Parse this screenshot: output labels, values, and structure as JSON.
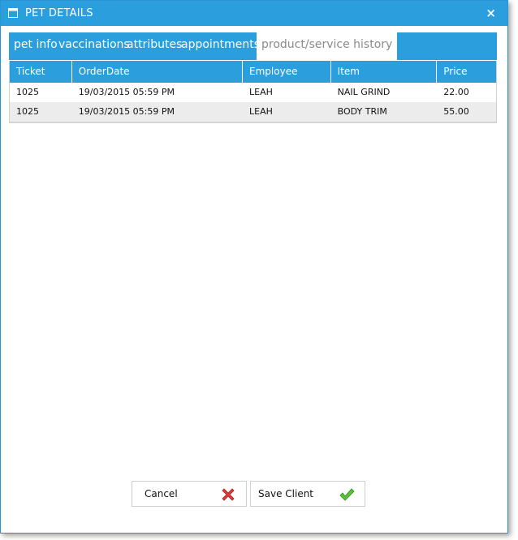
{
  "window": {
    "title": "PET DETAILS",
    "close_glyph": "×",
    "accent_color": "#2b9fde"
  },
  "tabs": [
    {
      "label": "pet info"
    },
    {
      "label": "vaccinations"
    },
    {
      "label": "attributes"
    },
    {
      "label": "appointments"
    },
    {
      "label": "product/service history",
      "active": true
    }
  ],
  "table": {
    "columns": [
      "Ticket",
      "OrderDate",
      "Employee",
      "Item",
      "Price"
    ],
    "rows": [
      [
        "1025",
        "19/03/2015 05:59 PM",
        "LEAH",
        "NAIL GRIND",
        "22.00"
      ],
      [
        "1025",
        "19/03/2015 05:59 PM",
        "LEAH",
        "BODY TRIM",
        "55.00"
      ]
    ]
  },
  "buttons": {
    "cancel_label": "Cancel",
    "cancel_icon": "red-x-icon",
    "save_label": "Save Client",
    "save_icon": "green-check-icon"
  }
}
